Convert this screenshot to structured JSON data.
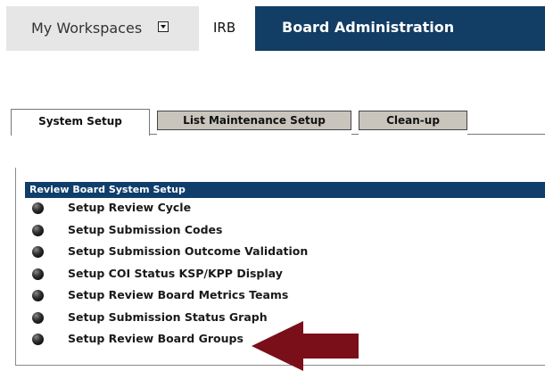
{
  "topnav": {
    "workspaces_label": "My Workspaces",
    "irb_label": "IRB",
    "board_label": "Board Administration"
  },
  "tabs": [
    {
      "label": "System Setup",
      "active": true
    },
    {
      "label": "List Maintenance Setup",
      "active": false
    },
    {
      "label": "Clean-up",
      "active": false
    }
  ],
  "panel": {
    "header": "Review Board System Setup",
    "items": [
      {
        "label": "Setup Review Cycle"
      },
      {
        "label": "Setup Submission Codes"
      },
      {
        "label": "Setup Submission Outcome Validation"
      },
      {
        "label": "Setup COI Status KSP/KPP Display"
      },
      {
        "label": "Setup Review Board Metrics Teams"
      },
      {
        "label": "Setup Submission Status Graph"
      },
      {
        "label": "Setup Review Board Groups"
      }
    ]
  },
  "colors": {
    "nav_active_bg": "#123d64",
    "panel_header_bg": "#0f3e6b",
    "inactive_tab_bg": "#c9c5bd",
    "annotation_arrow": "#7a0f1a"
  },
  "icons": {
    "dropdown": "dropdown-arrow-icon",
    "bullet": "bullet-icon",
    "annotation": "annotation-arrow-icon"
  }
}
